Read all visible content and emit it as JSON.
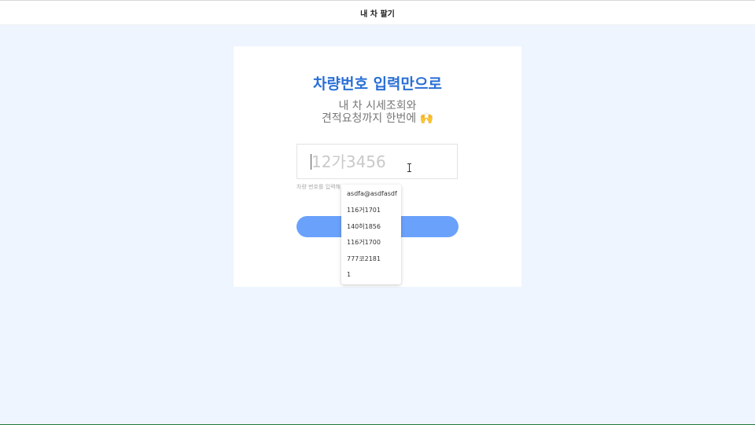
{
  "header": {
    "title": "내 차 팔기"
  },
  "hero": {
    "headline": "차량번호 입력만으로",
    "subline1": "내 차 시세조회와",
    "subline2": "견적요청까지 한번에",
    "emoji": "🙌"
  },
  "plate_input": {
    "placeholder": "12가3456",
    "value": ""
  },
  "hint_text": "차량 번호를 입력해",
  "submit_button": {
    "label": ""
  },
  "bottom_link_text": "",
  "autocomplete": {
    "items": [
      "asdfa@asdfasdf",
      "116거1701",
      "140허1856",
      "116거1700",
      "777코2181",
      "1"
    ]
  }
}
